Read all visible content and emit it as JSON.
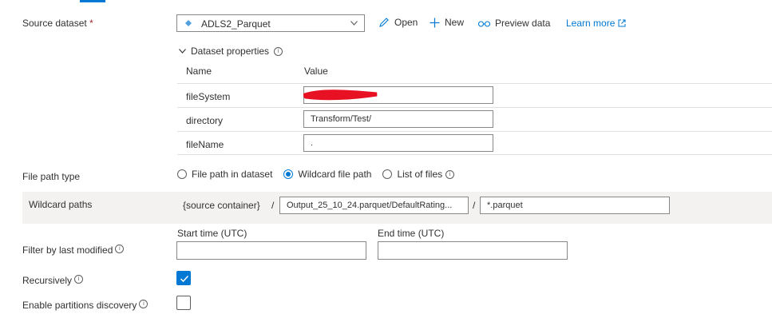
{
  "source_dataset": {
    "label": "Source dataset",
    "required_mark": "*",
    "selected": "ADLS2_Parquet",
    "actions": {
      "open": "Open",
      "new": "New",
      "preview": "Preview data",
      "learn_more": "Learn more"
    }
  },
  "dataset_properties": {
    "title": "Dataset properties",
    "col_name": "Name",
    "col_value": "Value",
    "rows": [
      {
        "name": "fileSystem",
        "value": ""
      },
      {
        "name": "directory",
        "value": "Transform/Test/"
      },
      {
        "name": "fileName",
        "value": "."
      }
    ]
  },
  "file_path_type": {
    "label": "File path type",
    "options": [
      "File path in dataset",
      "Wildcard file path",
      "List of files"
    ],
    "selected": "Wildcard file path"
  },
  "wildcard": {
    "label": "Wildcard paths",
    "container": "{source container}",
    "sep": "/",
    "folder": "Output_25_10_24.parquet/DefaultRating...",
    "file": "*.parquet"
  },
  "filter": {
    "label": "Filter by last modified",
    "start_label": "Start time (UTC)",
    "end_label": "End time (UTC)",
    "start_value": "",
    "end_value": ""
  },
  "recursively": {
    "label": "Recursively",
    "checked": true
  },
  "partitions": {
    "label": "Enable partitions discovery",
    "checked": false
  },
  "colors": {
    "accent": "#0078d4",
    "redaction": "#e81123"
  }
}
